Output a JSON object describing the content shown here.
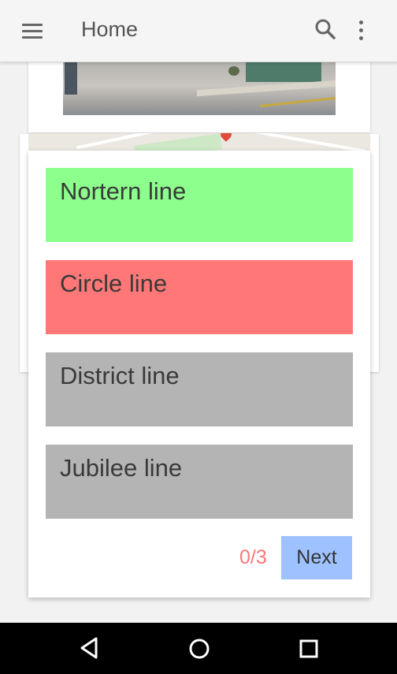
{
  "app_bar": {
    "title": "Home",
    "icons": [
      "menu-icon",
      "search-icon",
      "more-vert-icon"
    ]
  },
  "quiz": {
    "options": [
      {
        "label": "Nortern line",
        "color": "#8cff8c",
        "state": "correct"
      },
      {
        "label": "Circle line",
        "color": "#ff7777",
        "state": "wrong"
      },
      {
        "label": "District line",
        "color": "#b4b4b4",
        "state": "neutral"
      },
      {
        "label": "Jubilee line",
        "color": "#b4b4b4",
        "state": "neutral"
      }
    ],
    "score": "0/3",
    "next_label": "Next"
  },
  "nav_bar": {
    "icons": [
      "back-icon",
      "home-icon",
      "recents-icon"
    ]
  },
  "colors": {
    "correct": "#8cff8c",
    "wrong": "#ff7777",
    "neutral": "#b4b4b4",
    "next_button": "#9ec2ff",
    "score_text": "#ff7777"
  }
}
